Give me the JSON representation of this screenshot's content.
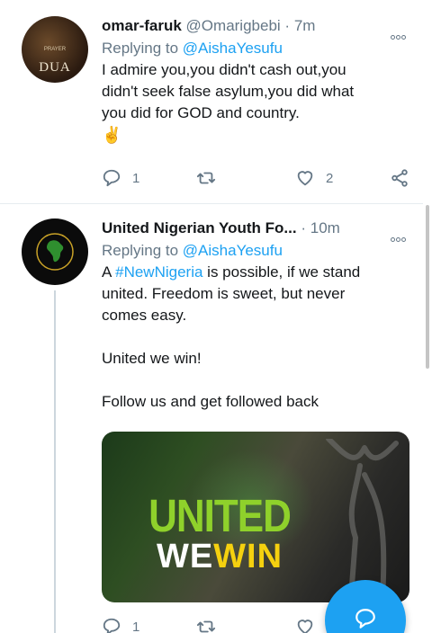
{
  "tweets": [
    {
      "name": "omar-faruk",
      "handle": "@Omarigbebi",
      "separator": "·",
      "time": "7m",
      "reply_prefix": "Replying to ",
      "reply_to": "@AishaYesufu",
      "avatar_text": "DUA",
      "avatar_subtext": "PRAYER",
      "lines": [
        "I admire you,you didn't cash out,you",
        "didn't seek false asylum,you did what",
        "you did for GOD and country."
      ],
      "emoji": "✌️",
      "reply_count": "1",
      "like_count": "2"
    },
    {
      "name": "United Nigerian Youth Fo...",
      "separator": "·",
      "time": "10m",
      "reply_prefix": "Replying to ",
      "reply_to": "@AishaYesufu",
      "text_prefix": "A ",
      "hashtag": "#NewNigeria",
      "text_rest": " is possible, if we stand",
      "lines": [
        "united. Freedom is sweet, but never",
        "comes easy."
      ],
      "line_united": "United we win!",
      "line_follow": "Follow us and get followed back",
      "media": {
        "title_top": "UNITED",
        "title_we": "WE",
        "title_win": "WIN"
      },
      "reply_count": "1"
    }
  ],
  "colors": {
    "accent": "#1da1f2",
    "secondary_text": "#657786",
    "primary_text": "#14171a",
    "divider": "#e6ecf0"
  },
  "icons": {
    "reply": "reply-icon",
    "retweet": "retweet-icon",
    "like": "heart-icon",
    "share": "share-icon",
    "more": "more-icon",
    "compose": "compose-reply-icon"
  }
}
